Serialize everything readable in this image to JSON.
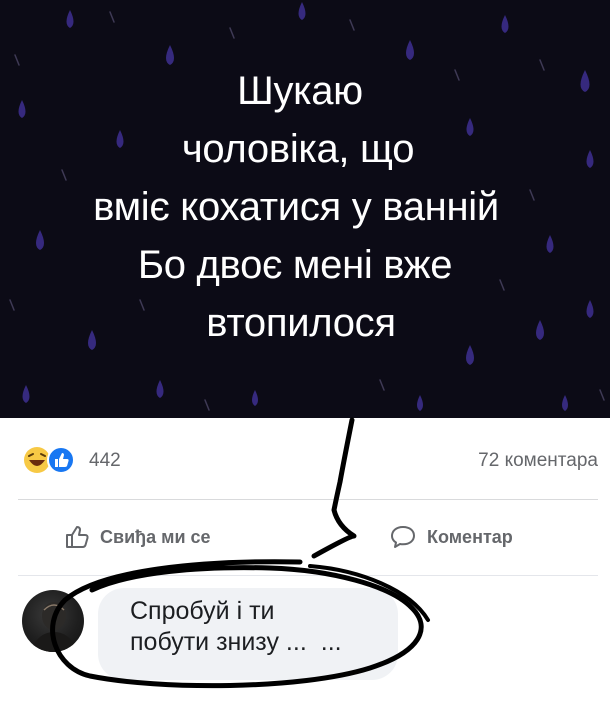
{
  "post": {
    "lines": [
      "Шукаю",
      "чоловіка, що",
      "вміє кохатися у ванній",
      "Бо двоє мені вже",
      "втопилося"
    ]
  },
  "reactions": {
    "icons": [
      "laugh-reaction-icon",
      "like-reaction-icon"
    ],
    "count": "442",
    "comments": "72 коментара"
  },
  "actions": {
    "like_label": "Свиђа ми се",
    "comment_label": "Коментар"
  },
  "comment": {
    "line1": "Спробуй і ти",
    "line2": "побути знизу ...",
    "more": "..."
  },
  "colors": {
    "image_bg": "#0c0b16",
    "drops": "#3b2d8a",
    "like_blue": "#1877f2",
    "laugh_yellow": "#f7c945",
    "annotation_ink": "#000000"
  }
}
